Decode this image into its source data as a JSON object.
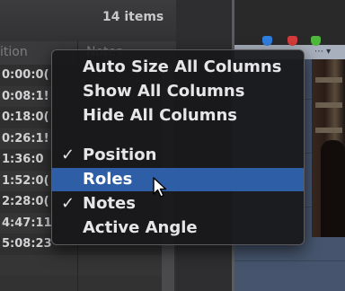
{
  "list": {
    "item_count": "14 items",
    "column_header_position": "ition",
    "column_header_notes": "Notes",
    "rows": [
      "0:00:0(",
      "0:08:1!",
      "0:18:0(",
      "0:26:1!",
      "1:36:0",
      "1:52:0(",
      "2:28:0(",
      "4:47:11",
      "5:08:23",
      ""
    ]
  },
  "menu": {
    "items": [
      {
        "label": "Auto Size All Columns",
        "checked": false
      },
      {
        "label": "Show All Columns",
        "checked": false
      },
      {
        "label": "Hide All Columns",
        "checked": false
      },
      {
        "label": "Position",
        "checked": true
      },
      {
        "label": "Roles",
        "checked": false,
        "highlighted": true
      },
      {
        "label": "Notes",
        "checked": true
      },
      {
        "label": "Active Angle",
        "checked": false
      }
    ],
    "check_glyph": "✓"
  },
  "colors": {
    "menu_highlight": "#2e5fa6",
    "marker_blue": "#2f7fe0",
    "marker_red": "#d63b3b",
    "marker_green": "#4fb83c"
  },
  "icons": [
    "arrow-cursor-icon",
    "marker-icon"
  ]
}
